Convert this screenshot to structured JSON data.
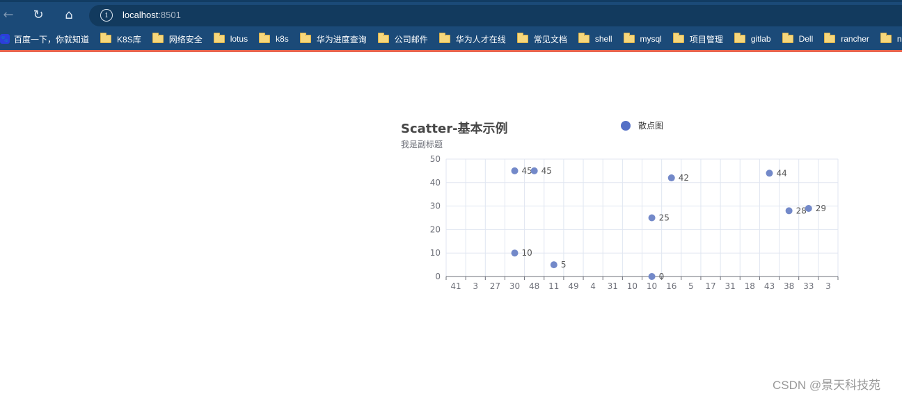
{
  "browser": {
    "url_host": "localhost",
    "url_port": ":8501",
    "nav": {
      "back_icon": "←",
      "reload_icon": "↻",
      "home_icon": "⌂",
      "info_icon": "i"
    },
    "bookmarks": [
      {
        "label": "百度一下，你就知道",
        "icon": "baidu-icon"
      },
      {
        "label": "K8S库",
        "icon": "folder-icon"
      },
      {
        "label": "网络安全",
        "icon": "folder-icon"
      },
      {
        "label": "lotus",
        "icon": "folder-icon"
      },
      {
        "label": "k8s",
        "icon": "folder-icon"
      },
      {
        "label": "华为进度查询",
        "icon": "folder-icon"
      },
      {
        "label": "公司邮件",
        "icon": "folder-icon"
      },
      {
        "label": "华为人才在线",
        "icon": "folder-icon"
      },
      {
        "label": "常见文档",
        "icon": "folder-icon"
      },
      {
        "label": "shell",
        "icon": "folder-icon"
      },
      {
        "label": "mysql",
        "icon": "folder-icon"
      },
      {
        "label": "项目管理",
        "icon": "folder-icon"
      },
      {
        "label": "gitlab",
        "icon": "folder-icon"
      },
      {
        "label": "Dell",
        "icon": "folder-icon"
      },
      {
        "label": "rancher",
        "icon": "folder-icon"
      },
      {
        "label": "n",
        "icon": "folder-icon"
      }
    ]
  },
  "watermark": "CSDN @景天科技苑",
  "chart_data": {
    "type": "scatter",
    "title": "Scatter-基本示例",
    "subtitle": "我是副标题",
    "legend": {
      "entries": [
        "散点图"
      ],
      "position": "top-center"
    },
    "colors": {
      "series": "#5470c6",
      "point": "#7389c9"
    },
    "xaxis": {
      "type": "category",
      "categories": [
        "41",
        "3",
        "27",
        "30",
        "48",
        "11",
        "49",
        "4",
        "31",
        "10",
        "10",
        "16",
        "5",
        "17",
        "31",
        "18",
        "43",
        "38",
        "33",
        "3"
      ]
    },
    "yaxis": {
      "type": "value",
      "ylim": [
        0,
        50
      ],
      "ticks": [
        0,
        10,
        20,
        30,
        40,
        50
      ]
    },
    "grid": true,
    "series": [
      {
        "name": "散点图",
        "points": [
          {
            "x_index": 3,
            "y": 45
          },
          {
            "x_index": 4,
            "y": 45
          },
          {
            "x_index": 3,
            "y": 10
          },
          {
            "x_index": 5,
            "y": 5
          },
          {
            "x_index": 10,
            "y": 25
          },
          {
            "x_index": 11,
            "y": 42
          },
          {
            "x_index": 10,
            "y": 0
          },
          {
            "x_index": 16,
            "y": 44
          },
          {
            "x_index": 17,
            "y": 28
          },
          {
            "x_index": 18,
            "y": 29
          }
        ]
      }
    ]
  }
}
